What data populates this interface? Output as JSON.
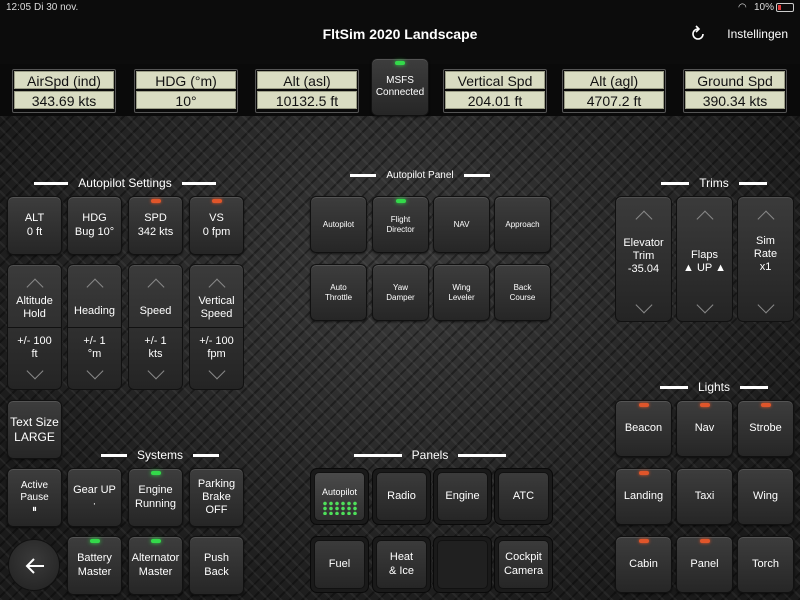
{
  "status_bar": {
    "time": "12:05",
    "date": "Di 30 nov.",
    "battery": "10%"
  },
  "nav": {
    "title": "FltSim 2020 Landscape",
    "settings_label": "Instellingen"
  },
  "readouts": [
    {
      "label": "AirSpd (ind)",
      "value": "343.69 kts"
    },
    {
      "label": "HDG (°m)",
      "value": "10°"
    },
    {
      "label": "Alt (asl)",
      "value": "10132.5 ft"
    },
    {
      "label": "Vertical Spd",
      "value": "204.01 ft"
    },
    {
      "label": "Alt (agl)",
      "value": "4707.2 ft"
    },
    {
      "label": "Ground Spd",
      "value": "390.34 kts"
    }
  ],
  "msfs": {
    "line1": "MSFS",
    "line2": "Connected"
  },
  "autopilot_settings": {
    "title": "Autopilot Settings",
    "top": [
      {
        "l1": "ALT",
        "l2": "0 ft"
      },
      {
        "l1": "HDG",
        "l2": "Bug 10°"
      },
      {
        "l1": "SPD",
        "l2": "342 kts"
      },
      {
        "l1": "VS",
        "l2": "0 fpm"
      }
    ],
    "steppers": [
      {
        "l1": "Altitude",
        "l2": "Hold",
        "s1": "+/- 100",
        "s2": "ft"
      },
      {
        "l1": "Heading",
        "l2": "",
        "s1": "+/- 1",
        "s2": "°m"
      },
      {
        "l1": "Speed",
        "l2": "",
        "s1": "+/- 1",
        "s2": "kts"
      },
      {
        "l1": "Vertical",
        "l2": "Speed",
        "s1": "+/- 100",
        "s2": "fpm"
      }
    ]
  },
  "autopilot_panel": {
    "title": "Autopilot Panel",
    "row1": [
      {
        "l1": "Autopilot",
        "l2": ""
      },
      {
        "l1": "Flight",
        "l2": "Director"
      },
      {
        "l1": "NAV",
        "l2": ""
      },
      {
        "l1": "Approach",
        "l2": ""
      }
    ],
    "row2": [
      {
        "l1": "Auto",
        "l2": "Throttle"
      },
      {
        "l1": "Yaw",
        "l2": "Damper"
      },
      {
        "l1": "Wing",
        "l2": "Leveler"
      },
      {
        "l1": "Back",
        "l2": "Course"
      }
    ]
  },
  "trims": {
    "title": "Trims",
    "items": [
      {
        "l1": "Elevator",
        "l2": "Trim",
        "value": "-35.04"
      },
      {
        "l1": "Flaps",
        "l2": "",
        "value": "▲ UP ▲"
      },
      {
        "l1": "Sim",
        "l2": "Rate",
        "value": "x1"
      }
    ]
  },
  "text_size": {
    "l1": "Text Size",
    "l2": "LARGE"
  },
  "systems": {
    "title": "Systems",
    "row1": [
      {
        "l1": "Active",
        "l2": "Pause",
        "l3": "⏸"
      },
      {
        "l1": "Gear UP",
        "l2": "",
        "l3": "·"
      },
      {
        "l1": "Engine",
        "l2": "Running",
        "l3": ""
      },
      {
        "l1": "Parking",
        "l2": "Brake",
        "l3": "OFF"
      }
    ],
    "row2": [
      {
        "l1": "Battery",
        "l2": "Master"
      },
      {
        "l1": "Alternator",
        "l2": "Master"
      },
      {
        "l1": "Push",
        "l2": "Back"
      }
    ]
  },
  "panels": {
    "title": "Panels",
    "row1": [
      {
        "l1": "Autopilot",
        "l2": ""
      },
      {
        "l1": "Radio",
        "l2": ""
      },
      {
        "l1": "Engine",
        "l2": ""
      },
      {
        "l1": "ATC",
        "l2": ""
      }
    ],
    "row2": [
      {
        "l1": "Fuel",
        "l2": ""
      },
      {
        "l1": "Heat",
        "l2": "& Ice"
      },
      {
        "l1": "",
        "l2": ""
      },
      {
        "l1": "Cockpit",
        "l2": "Camera"
      }
    ]
  },
  "lights": {
    "title": "Lights",
    "items": [
      "Beacon",
      "Nav",
      "Strobe",
      "Landing",
      "Taxi",
      "Wing",
      "Cabin",
      "Panel",
      "Torch"
    ]
  },
  "colors": {
    "led_green": "#33d94a",
    "led_red": "#e0552a",
    "readout_bg": "#d9dcc2"
  }
}
